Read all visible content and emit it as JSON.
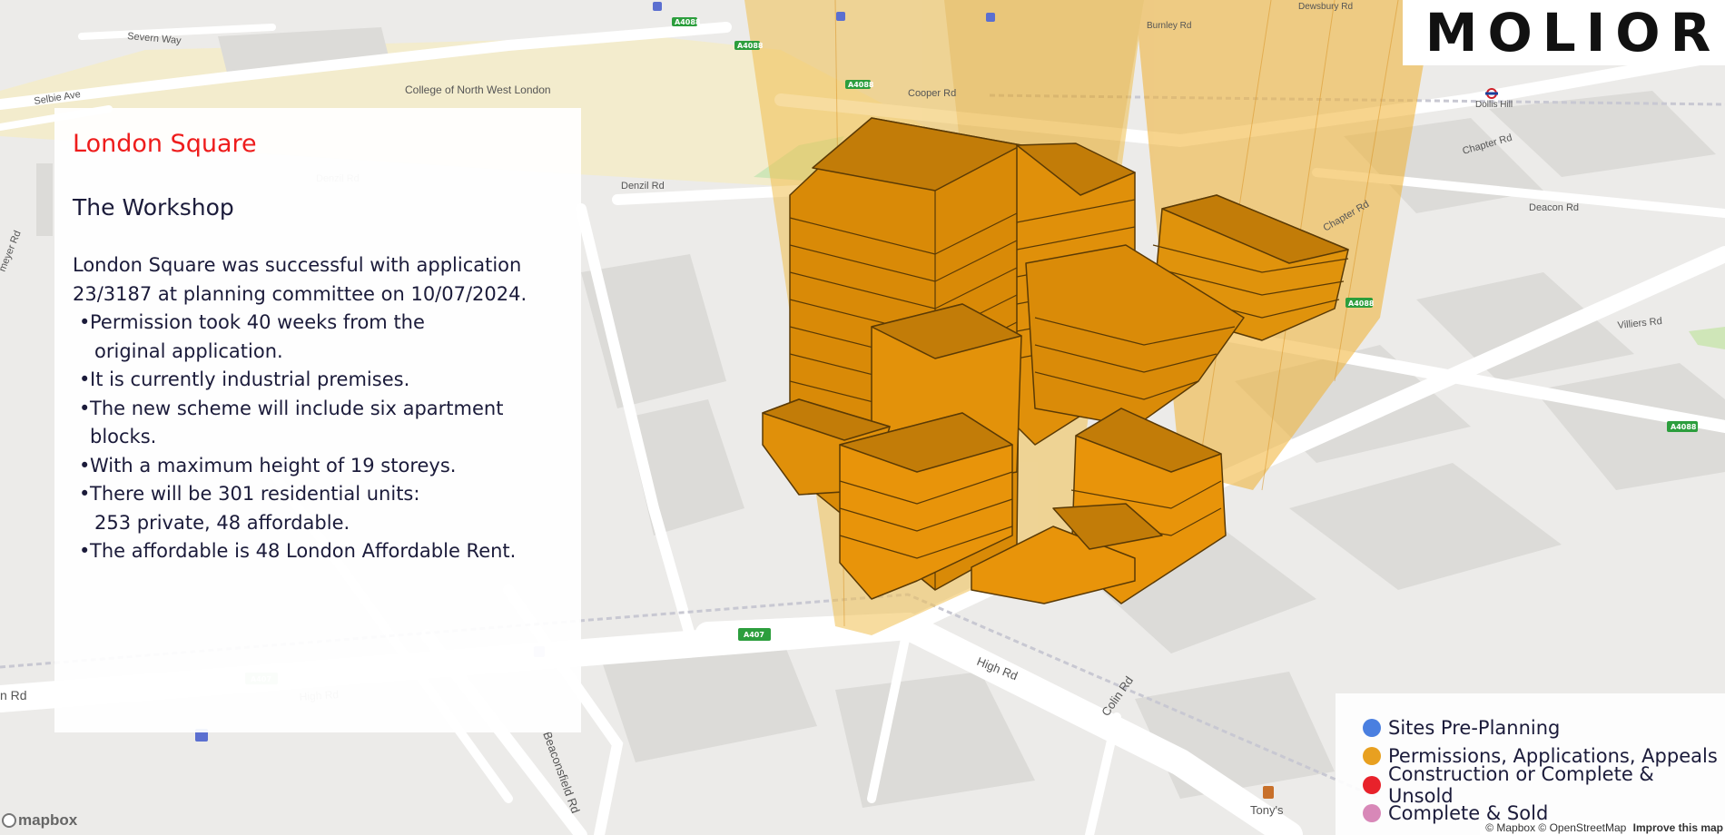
{
  "map": {
    "roads": {
      "severn_way": "Severn Way",
      "selbie_ave": "Selbie Ave",
      "denzil_rd": "Denzil Rd",
      "cooper_rd": "Cooper Rd",
      "burnley_rd": "Burnley Rd",
      "dewsbury_rd": "Dewsbury Rd",
      "chapter_rd": "Chapter Rd",
      "deacon_rd": "Deacon Rd",
      "villiers_rd": "Villiers Rd",
      "high_rd": "High Rd",
      "colin_rd": "Colin Rd",
      "beaconsfield_rd": "Beaconsfield Rd",
      "n_rd": "n Rd",
      "meyer_rd": "meyer Rd"
    },
    "pois": {
      "college": "College of North West London",
      "dollis_hill": "Dollis Hill",
      "tonys": "Tony's"
    },
    "shields": {
      "a4088": "A4088",
      "a407": "A407"
    },
    "colors": {
      "building": "#e8940a",
      "building_edge": "#5a3a05",
      "column": "#f0b83a"
    }
  },
  "info": {
    "title": "London Square",
    "subtitle": "The Workshop",
    "intro": [
      "London Square was successful with application",
      "23/3187 at planning committee on 10/07/2024."
    ],
    "bullets": [
      {
        "text": "Permission took 40 weeks from the",
        "cont": "original application."
      },
      {
        "text": "It is currently industrial premises."
      },
      {
        "text": "The new scheme will include six apartment blocks."
      },
      {
        "text": "With a maximum height of 19 storeys."
      },
      {
        "text": "There will be 301 residential units:",
        "cont": "253 private, 48 affordable."
      },
      {
        "text": "The affordable is 48 London Affordable Rent."
      }
    ],
    "title_color": "#ee1c1c"
  },
  "logo": {
    "text": "MOLIOR"
  },
  "legend": {
    "items": [
      {
        "label": "Sites Pre-Planning",
        "color": "#4a7fe0"
      },
      {
        "label": "Permissions, Applications, Appeals",
        "color": "#e8a020"
      },
      {
        "label": "Construction or Complete & Unsold",
        "color": "#e8222b"
      },
      {
        "label": "Complete & Sold",
        "color": "#d888b8"
      }
    ]
  },
  "attribution": {
    "text": "© Mapbox © OpenStreetMap",
    "improve": "Improve this map",
    "mapbox": "mapbox"
  }
}
